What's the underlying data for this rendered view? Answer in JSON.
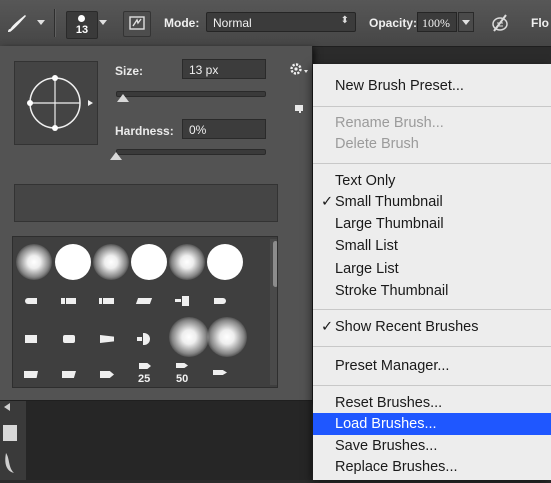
{
  "options_bar": {
    "brush_size_value": "13",
    "mode_label": "Mode:",
    "mode_value": "Normal",
    "opacity_label": "Opacity:",
    "opacity_value": "100%",
    "flow_label": "Flo"
  },
  "picker": {
    "size_label": "Size:",
    "size_value": "13 px",
    "size_slider_fraction": 0.05,
    "hardness_label": "Hardness:",
    "hardness_value": "0%",
    "hardness_slider_fraction": 0.0,
    "thumb_numbers": [
      "25",
      "50"
    ]
  },
  "menu": {
    "items": [
      {
        "label": "New Brush Preset...",
        "checked": false,
        "disabled": false
      },
      {
        "label": "Rename Brush...",
        "checked": false,
        "disabled": true
      },
      {
        "label": "Delete Brush",
        "checked": false,
        "disabled": true
      },
      {
        "label": "Text Only",
        "checked": false,
        "disabled": false
      },
      {
        "label": "Small Thumbnail",
        "checked": true,
        "disabled": false
      },
      {
        "label": "Large Thumbnail",
        "checked": false,
        "disabled": false
      },
      {
        "label": "Small List",
        "checked": false,
        "disabled": false
      },
      {
        "label": "Large List",
        "checked": false,
        "disabled": false
      },
      {
        "label": "Stroke Thumbnail",
        "checked": false,
        "disabled": false
      },
      {
        "label": "Show Recent Brushes",
        "checked": true,
        "disabled": false
      },
      {
        "label": "Preset Manager...",
        "checked": false,
        "disabled": false
      },
      {
        "label": "Reset Brushes...",
        "checked": false,
        "disabled": false
      },
      {
        "label": "Load Brushes...",
        "checked": false,
        "disabled": false,
        "highlighted": true
      },
      {
        "label": "Save Brushes...",
        "checked": false,
        "disabled": false
      },
      {
        "label": "Replace Brushes...",
        "checked": false,
        "disabled": false
      }
    ],
    "checkmark": "✓"
  },
  "colors": {
    "menu_highlight": "#1f57ff",
    "menu_background": "#ededed",
    "panel_background": "#535353"
  }
}
